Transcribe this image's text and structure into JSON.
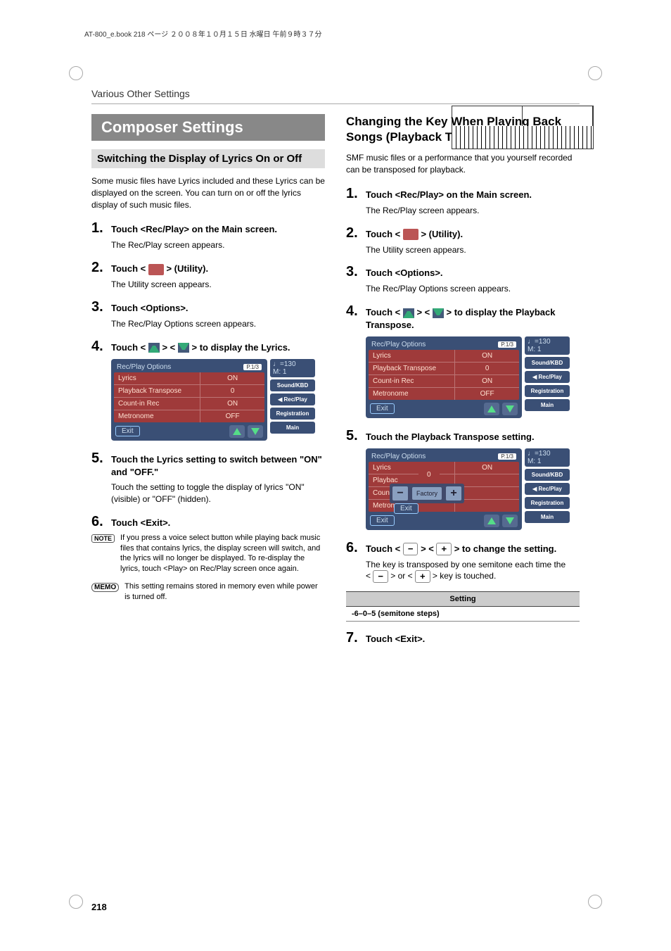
{
  "header_stamp": "AT-800_e.book 218 ページ ２００８年１０月１５日 水曜日 午前９時３７分",
  "chapter": "Various Other Settings",
  "page_number": "218",
  "left": {
    "h1": "Composer Settings",
    "h2": "Switching the Display of Lyrics On or Off",
    "intro": "Some music files have Lyrics included and these Lyrics can be displayed on the screen. You can turn on or off the lyrics display of such music files.",
    "steps": [
      {
        "num": "1.",
        "title": "Touch <Rec/Play> on the Main screen.",
        "body": "The Rec/Play screen appears."
      },
      {
        "num": "2.",
        "title_pre": "Touch < ",
        "title_post": " > (Utility).",
        "body": "The Utility screen appears."
      },
      {
        "num": "3.",
        "title": "Touch <Options>.",
        "body": "The Rec/Play Options screen appears."
      },
      {
        "num": "4.",
        "title_pre": "Touch < ",
        "title_mid": " > < ",
        "title_post": " > to display the Lyrics."
      },
      {
        "num": "5.",
        "title": "Touch the Lyrics setting to switch between \"ON\" and \"OFF.\"",
        "body": "Touch the setting to toggle the display of lyrics \"ON\" (visible) or \"OFF\" (hidden)."
      },
      {
        "num": "6.",
        "title": "Touch <Exit>."
      }
    ],
    "note": "If you press a voice select button while playing back music files that contains lyrics, the display screen will switch, and the lyrics will no longer be displayed. To re-display the lyrics, touch <Play> on Rec/Play screen once again.",
    "memo": "This setting remains stored in memory even while power is turned off.",
    "note_label": "NOTE",
    "memo_label": "MEMO"
  },
  "right": {
    "h2": "Changing the Key When Playing Back Songs (Playback Transpose)",
    "intro": "SMF music files or a performance that you yourself recorded can be transposed for playback.",
    "steps": [
      {
        "num": "1.",
        "title": "Touch <Rec/Play> on the Main screen.",
        "body": "The Rec/Play screen appears."
      },
      {
        "num": "2.",
        "title_pre": "Touch < ",
        "title_post": " > (Utility).",
        "body": "The Utility screen appears."
      },
      {
        "num": "3.",
        "title": "Touch <Options>.",
        "body": "The Rec/Play Options screen appears."
      },
      {
        "num": "4.",
        "title_pre": "Touch < ",
        "title_mid": " > < ",
        "title_post": " > to display the Playback Transpose."
      },
      {
        "num": "5.",
        "title": "Touch the Playback Transpose setting."
      },
      {
        "num": "6.",
        "title_pre": "Touch < ",
        "title_mid": " > < ",
        "title_post": " > to change the setting.",
        "body": "The key is transposed by one semitone each time the",
        "body2_pre": "< ",
        "body2_mid": " > or < ",
        "body2_post": " > key is touched."
      },
      {
        "num": "7.",
        "title": "Touch <Exit>."
      }
    ],
    "setting_header": "Setting",
    "setting_value": "-6–0–5 (semitone steps)"
  },
  "screen": {
    "title": "Rec/Play Options",
    "page_indicator": "P.1/3",
    "tempo": "♩=130",
    "measure": "M:   1",
    "rows": [
      {
        "l": "Lyrics",
        "r": "ON"
      },
      {
        "l": "Playback Transpose",
        "r": "0"
      },
      {
        "l": "Count-in Rec",
        "r": "ON"
      },
      {
        "l": "Metronome",
        "r": "OFF"
      }
    ],
    "exit": "Exit",
    "side": [
      "Sound/KBD",
      "◀ Rec/Play",
      "Registration",
      "Main"
    ],
    "popup": {
      "minus": "−",
      "factory": "Factory",
      "plus": "+",
      "exit": "Exit",
      "val": "0"
    }
  }
}
